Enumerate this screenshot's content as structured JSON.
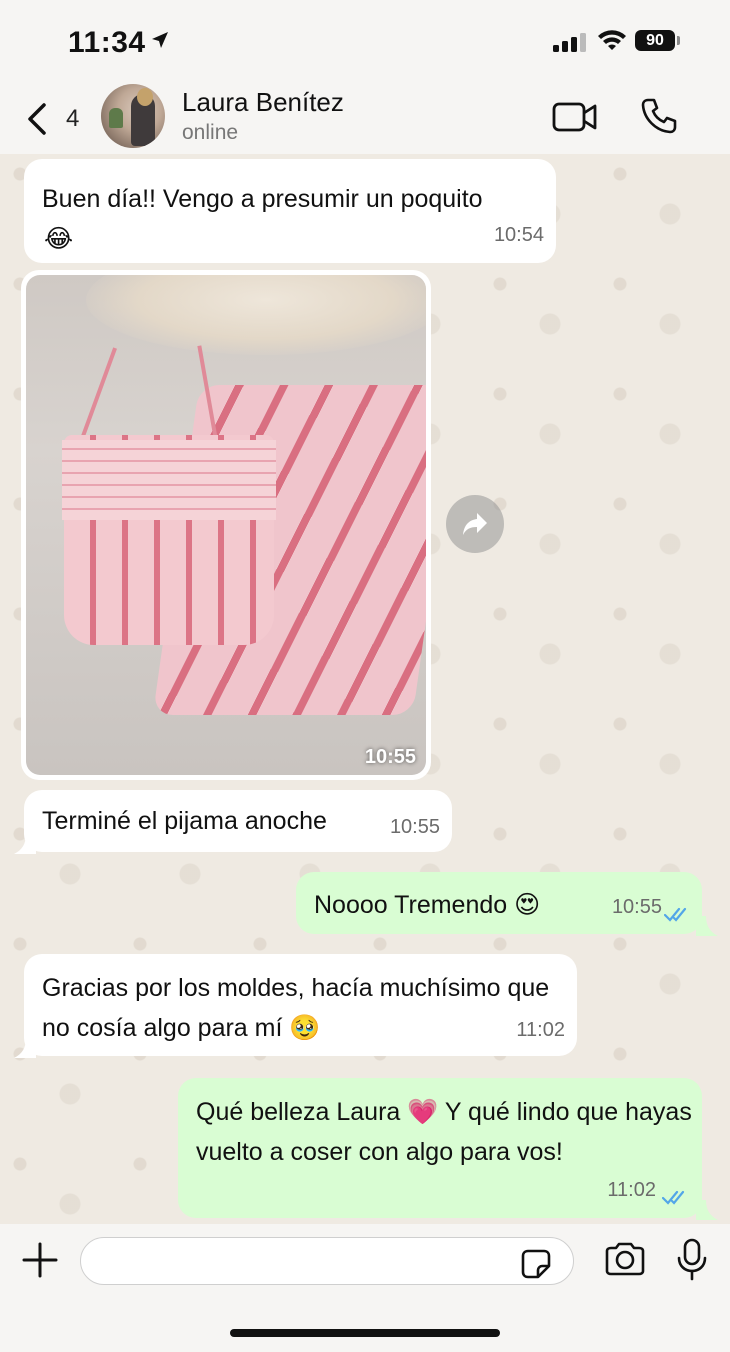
{
  "status_bar": {
    "time": "11:34",
    "battery": "90"
  },
  "header": {
    "back_count": "4",
    "contact_name": "Laura Benítez",
    "contact_status": "online"
  },
  "messages": [
    {
      "direction": "in",
      "text": "Buen día!! Vengo a presumir un poquito",
      "emoji": "😂",
      "time": "10:54"
    },
    {
      "direction": "in",
      "type": "photo",
      "time": "10:55"
    },
    {
      "direction": "in",
      "text": "Terminé el pijama anoche",
      "time": "10:55"
    },
    {
      "direction": "out",
      "text": "Noooo Tremendo 😍",
      "time": "10:55",
      "status": "read"
    },
    {
      "direction": "in",
      "text": "Gracias por los moldes, hacía muchísimo que no cosía algo para mí 🥹",
      "time": "11:02"
    },
    {
      "direction": "out",
      "text": "Qué belleza Laura 💗 Y qué lindo que hayas vuelto a coser con algo para vos!",
      "time": "11:02",
      "status": "read"
    }
  ],
  "input": {
    "placeholder": ""
  },
  "colors": {
    "outgoing_bubble": "#d9fdd3",
    "incoming_bubble": "#ffffff",
    "read_ticks": "#53a6e8",
    "chat_background": "#efeae2"
  }
}
